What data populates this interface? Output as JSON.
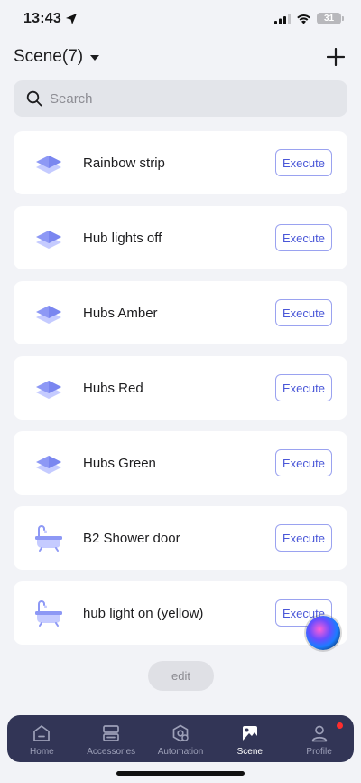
{
  "status": {
    "time": "13:43",
    "battery": "31"
  },
  "header": {
    "title": "Scene(7)"
  },
  "search": {
    "placeholder": "Search"
  },
  "scenes": [
    {
      "name": "Rainbow strip",
      "icon": "layers-icon",
      "action": "Execute"
    },
    {
      "name": "Hub lights off",
      "icon": "layers-icon",
      "action": "Execute"
    },
    {
      "name": "Hubs Amber",
      "icon": "layers-icon",
      "action": "Execute"
    },
    {
      "name": "Hubs Red",
      "icon": "layers-icon",
      "action": "Execute"
    },
    {
      "name": "Hubs Green",
      "icon": "layers-icon",
      "action": "Execute"
    },
    {
      "name": "B2 Shower door",
      "icon": "bathtub-icon",
      "action": "Execute"
    },
    {
      "name": "hub light on (yellow)",
      "icon": "bathtub-icon",
      "action": "Execute"
    }
  ],
  "edit_label": "edit",
  "tabs": [
    {
      "label": "Home",
      "icon": "home-icon"
    },
    {
      "label": "Accessories",
      "icon": "accessories-icon"
    },
    {
      "label": "Automation",
      "icon": "automation-icon"
    },
    {
      "label": "Scene",
      "icon": "scene-icon",
      "active": true
    },
    {
      "label": "Profile",
      "icon": "profile-icon",
      "badge": true
    }
  ],
  "colors": {
    "accent": "#4a57d8",
    "tabbar": "#323556",
    "badge": "#ff2d2d"
  }
}
